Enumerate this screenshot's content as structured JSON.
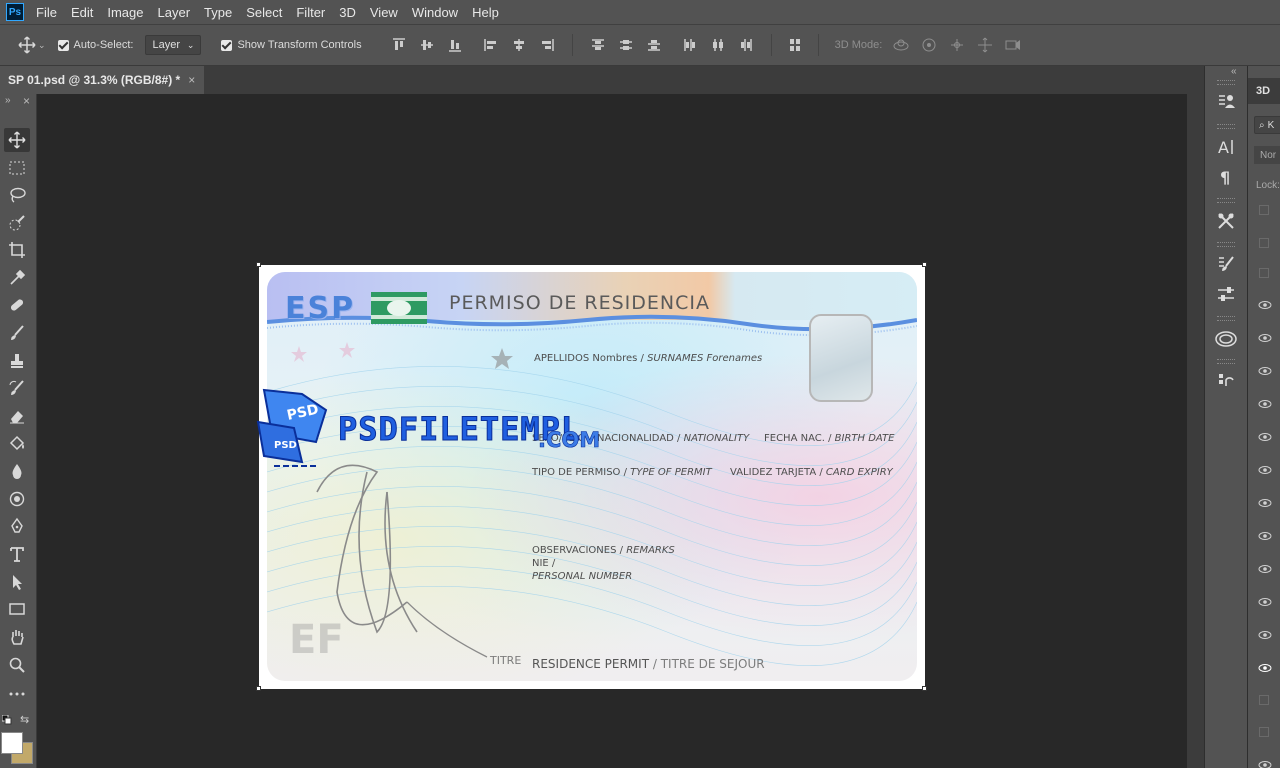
{
  "app": {
    "logo": "Ps"
  },
  "menu": [
    "File",
    "Edit",
    "Image",
    "Layer",
    "Type",
    "Select",
    "Filter",
    "3D",
    "View",
    "Window",
    "Help"
  ],
  "options": {
    "auto_select_label": "Auto-Select:",
    "auto_select_checked": true,
    "target_value": "Layer",
    "show_transform_label": "Show Transform Controls",
    "show_transform_checked": true,
    "mode_3d_label": "3D Mode:"
  },
  "document_tab": {
    "title": "SP 01.psd @ 31.3% (RGB/8#) *",
    "close": "×"
  },
  "panel_collapse_arrows": {
    "left": "»",
    "left_close": "×",
    "right": "«"
  },
  "layers_panel": {
    "tab": "3D",
    "search_prefix": "K",
    "blend_mode": "Nor",
    "lock_label": "Lock:"
  },
  "card": {
    "country": "ESP",
    "title": "PERMISO DE RESIDENCIA",
    "surnames": {
      "es": "APELLIDOS Nombres /",
      "en": "SURNAMES Forenames"
    },
    "sex": "SEXO/SEX",
    "nationality": {
      "es": "NACIONALIDAD /",
      "en": "NATIONALITY"
    },
    "birth": {
      "es": "FECHA NAC. /",
      "en": "BIRTH DATE"
    },
    "permit_type": {
      "es": "TIPO DE PERMISO /",
      "en": "TYPE OF PERMIT"
    },
    "expiry": {
      "es": "VALIDEZ TARJETA /",
      "en": "CARD EXPIRY"
    },
    "remarks": {
      "es": "OBSERVACIONES /",
      "en": "REMARKS"
    },
    "nie": "NIE /",
    "personal_number": "PERSONAL NUMBER",
    "titre": "TITRE",
    "residence": {
      "en": "RESIDENCE PERMIT",
      "fr": "/ TITRE DE SEJOUR"
    },
    "watermark_ef": "EF"
  },
  "watermark": {
    "text": "PSDFILETEMPL",
    "suffix": ".COM",
    "badge": "PSD"
  }
}
